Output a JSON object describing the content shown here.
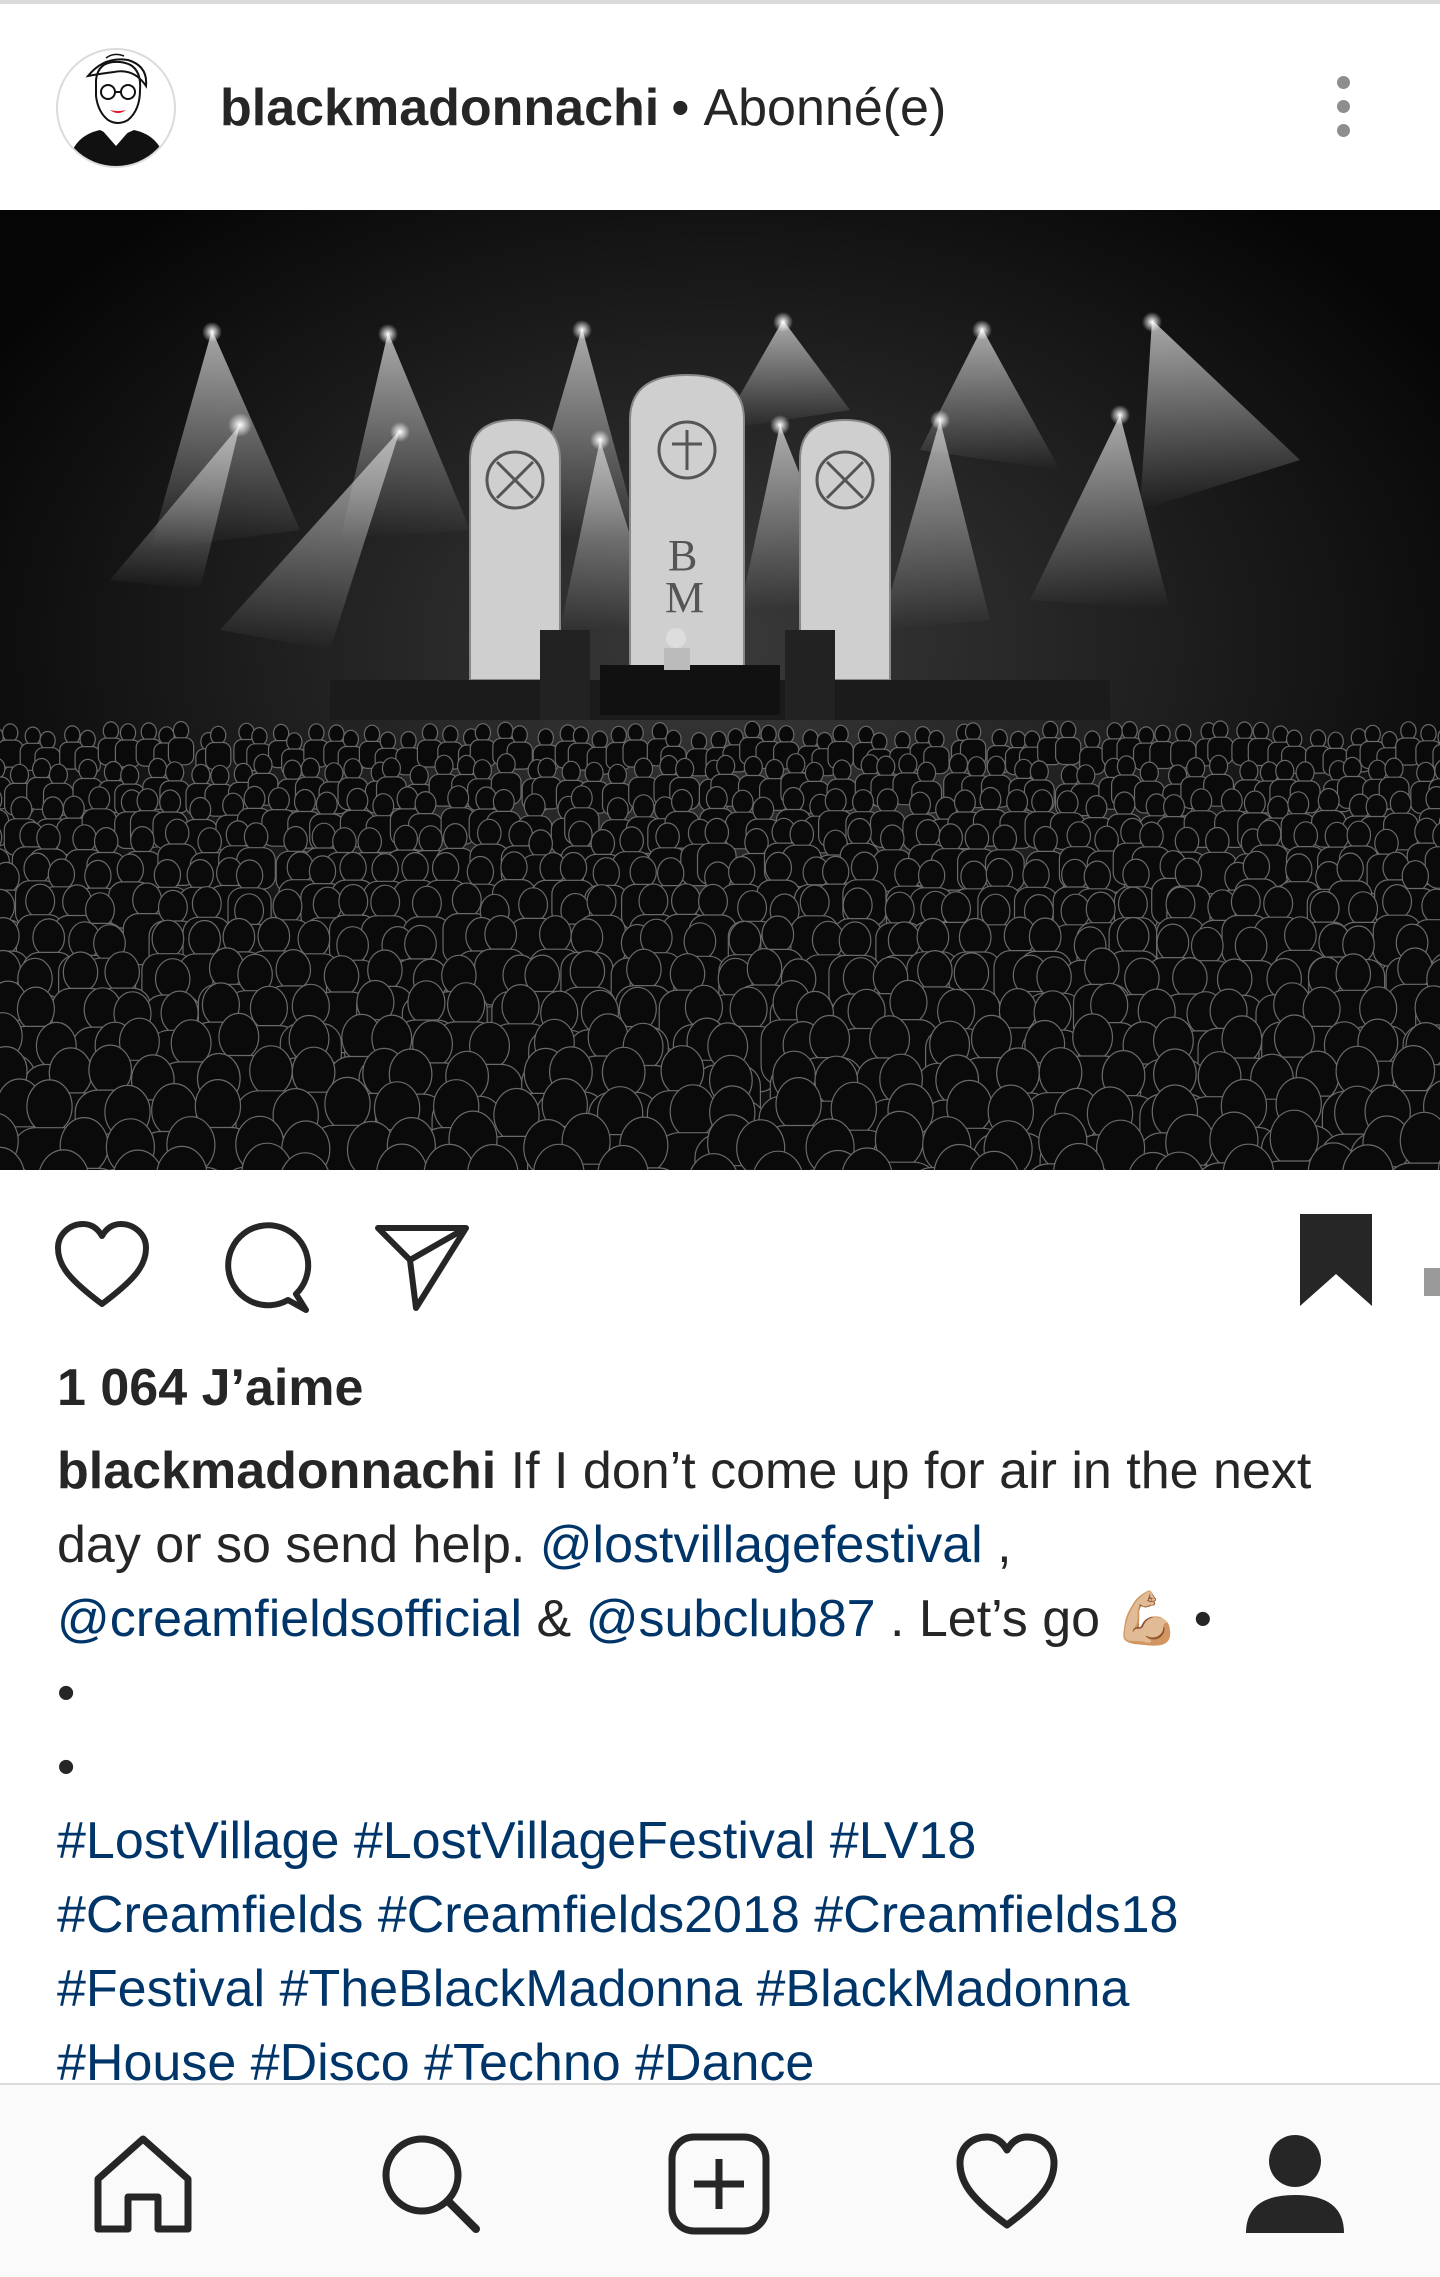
{
  "header": {
    "username": "blackmadonnachi",
    "separator": "•",
    "follow_status": "Abonné(e)",
    "more_icon": "vertical-ellipsis-icon"
  },
  "post": {
    "image_alt": "black-and-white concert stage with light beams over crowd",
    "stage_letters_top": "B",
    "stage_letters_bottom": "M"
  },
  "actions": {
    "like_icon": "heart-outline-icon",
    "comment_icon": "comment-bubble-icon",
    "share_icon": "paper-plane-icon",
    "save_icon": "bookmark-filled-icon"
  },
  "likes": {
    "text": "1 064 J’aime"
  },
  "caption": {
    "username": "blackmadonnachi",
    "line1_text": " If I don’t come up for air in the next",
    "line2_text": "day or so send help. ",
    "mention1": "@lostvillagefestival",
    "line2_end": " ,",
    "mention2": "@creamfieldsofficial",
    "amp": " & ",
    "mention3": "@subclub87",
    "line3_end": " . Let’s go 💪🏼 •",
    "dot_line": "•",
    "hashtags_line1": "#LostVillage #LostVillageFestival #LV18",
    "hashtags_line2": "#Creamfields #Creamfields2018 #Creamfields18",
    "hashtags_line3": "#Festival  #TheBlackMadonna #BlackMadonna",
    "hashtags_line4": "#House #Disco #Techno #Dance"
  },
  "nav": {
    "home_icon": "home-icon",
    "search_icon": "search-icon",
    "add_icon": "add-post-icon",
    "activity_icon": "heart-activity-icon",
    "profile_icon": "profile-icon"
  }
}
